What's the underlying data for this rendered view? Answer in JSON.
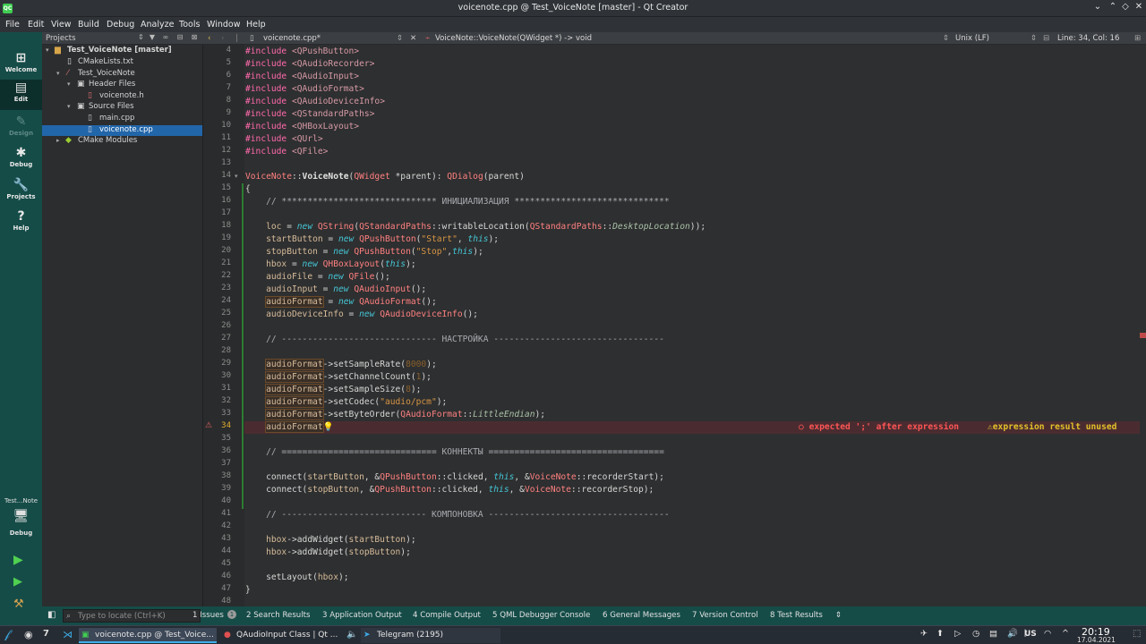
{
  "window": {
    "title": "voicenote.cpp @ Test_VoiceNote [master] - Qt Creator"
  },
  "menu": [
    "File",
    "Edit",
    "View",
    "Build",
    "Debug",
    "Analyze",
    "Tools",
    "Window",
    "Help"
  ],
  "modes": [
    {
      "label": "Welcome",
      "icon": "welcome-icon"
    },
    {
      "label": "Edit",
      "icon": "edit-icon"
    },
    {
      "label": "Design",
      "icon": "design-icon"
    },
    {
      "label": "Debug",
      "icon": "debug-icon"
    },
    {
      "label": "Projects",
      "icon": "projects-icon"
    },
    {
      "label": "Help",
      "icon": "help-icon"
    }
  ],
  "target": {
    "name": "Test...Note",
    "config": "Debug"
  },
  "projects": {
    "header": "Projects",
    "tree": [
      {
        "label": "Test_VoiceNote [master]",
        "level": 0,
        "bold": true,
        "icon": "folder"
      },
      {
        "label": "CMakeLists.txt",
        "level": 1,
        "icon": "file"
      },
      {
        "label": "Test_VoiceNote",
        "level": 1,
        "icon": "target"
      },
      {
        "label": "Header Files",
        "level": 2,
        "icon": "folder"
      },
      {
        "label": "voicenote.h",
        "level": 3,
        "icon": "header"
      },
      {
        "label": "Source Files",
        "level": 2,
        "icon": "folder"
      },
      {
        "label": "main.cpp",
        "level": 3,
        "icon": "cpp"
      },
      {
        "label": "voicenote.cpp",
        "level": 3,
        "icon": "cpp",
        "selected": true
      },
      {
        "label": "CMake Modules",
        "level": 1,
        "icon": "cmake"
      }
    ]
  },
  "editor": {
    "file": "voicenote.cpp*",
    "symbol": "VoiceNote::VoiceNote(QWidget *) -> void",
    "line_ending": "Unix (LF)",
    "cursor": "Line: 34, Col: 16",
    "first_line": 4,
    "error_line": 34,
    "error_msg": "expected ';' after expression",
    "warn_msg": "expression result unused"
  },
  "code": [
    "<span class=\"pp\">#include</span> <span class=\"inc\">&lt;QPushButton&gt;</span>",
    "<span class=\"pp\">#include</span> <span class=\"inc\">&lt;QAudioRecorder&gt;</span>",
    "<span class=\"pp\">#include</span> <span class=\"inc\">&lt;QAudioInput&gt;</span>",
    "<span class=\"pp\">#include</span> <span class=\"inc\">&lt;QAudioFormat&gt;</span>",
    "<span class=\"pp\">#include</span> <span class=\"inc\">&lt;QAudioDeviceInfo&gt;</span>",
    "<span class=\"pp\">#include</span> <span class=\"inc\">&lt;QStandardPaths&gt;</span>",
    "<span class=\"pp\">#include</span> <span class=\"inc\">&lt;QHBoxLayout&gt;</span>",
    "<span class=\"pp\">#include</span> <span class=\"inc\">&lt;QUrl&gt;</span>",
    "<span class=\"pp\">#include</span> <span class=\"inc\">&lt;QFile&gt;</span>",
    "",
    "<span class=\"cls\">VoiceNote</span>::<span class=\"bold\">VoiceNote</span>(<span class=\"cls\">QWidget</span> *parent): <span class=\"cls\">QDialog</span>(parent)",
    "{",
    "    <span class=\"com\">// ****************************** ИНИЦИАЛИЗАЦИЯ ******************************</span>",
    "",
    "    <span class=\"fld\">loc</span> = <span class=\"kw\">new</span> <span class=\"cls\">QString</span>(<span class=\"cls\">QStandardPaths</span>::writableLocation(<span class=\"cls\">QStandardPaths</span>::<span class=\"en\">DesktopLocation</span>));",
    "    <span class=\"fld\">startButton</span> = <span class=\"kw\">new</span> <span class=\"cls\">QPushButton</span>(<span class=\"str\">\"Start\"</span>, <span class=\"kw2\">this</span>);",
    "    <span class=\"fld\">stopButton</span> = <span class=\"kw\">new</span> <span class=\"cls\">QPushButton</span>(<span class=\"str\">\"Stop\"</span>,<span class=\"kw2\">this</span>);",
    "    <span class=\"fld\">hbox</span> = <span class=\"kw\">new</span> <span class=\"cls\">QHBoxLayout</span>(<span class=\"kw2\">this</span>);",
    "    <span class=\"fld\">audioFile</span> = <span class=\"kw\">new</span> <span class=\"cls\">QFile</span>();",
    "    <span class=\"fld\">audioInput</span> = <span class=\"kw\">new</span> <span class=\"cls\">QAudioInput</span>();",
    "    <span class=\"fld box\">audioFormat</span> = <span class=\"kw\">new</span> <span class=\"cls\">QAudioFormat</span>();",
    "    <span class=\"fld\">audioDeviceInfo</span> = <span class=\"kw\">new</span> <span class=\"cls\">QAudioDeviceInfo</span>();",
    "",
    "    <span class=\"com\">// ------------------------------ НАСТРОЙКА ---------------------------------</span>",
    "",
    "    <span class=\"fld box\">audioFormat</span>-&gt;setSampleRate(<span class=\"num\">8000</span>);",
    "    <span class=\"fld box\">audioFormat</span>-&gt;setChannelCount(<span class=\"num\">1</span>);",
    "    <span class=\"fld box\">audioFormat</span>-&gt;setSampleSize(<span class=\"num\">8</span>);",
    "    <span class=\"fld box\">audioFormat</span>-&gt;setCodec(<span class=\"str\">\"audio/pcm\"</span>);",
    "    <span class=\"fld box\">audioFormat</span>-&gt;setByteOrder(<span class=\"cls\">QAudioFormat</span>::<span class=\"en\">LittleEndian</span>);",
    "    <span class=\"fld box\">audioFormat</span><span style=\"color:#e6c229\">💡</span>",
    "",
    "    <span class=\"com\">// ============================== КОННЕКТЫ ==================================</span>",
    "",
    "    connect(<span class=\"fld\">startButton</span>, &amp;<span class=\"cls\">QPushButton</span>::clicked, <span class=\"kw2\">this</span>, &amp;<span class=\"cls\">VoiceNote</span>::recorderStart);",
    "    connect(<span class=\"fld\">stopButton</span>, &amp;<span class=\"cls\">QPushButton</span>::clicked, <span class=\"kw2\">this</span>, &amp;<span class=\"cls\">VoiceNote</span>::recorderStop);",
    "",
    "    <span class=\"com\">// ---------------------------- КОМПОНОВКА -----------------------------------</span>",
    "",
    "    <span class=\"fld\">hbox</span>-&gt;addWidget(<span class=\"fld\">startButton</span>);",
    "    <span class=\"fld\">hbox</span>-&gt;addWidget(<span class=\"fld\">stopButton</span>);",
    "",
    "    setLayout(<span class=\"fld\">hbox</span>);",
    "}",
    ""
  ],
  "status": {
    "locator_placeholder": "Type to locate (Ctrl+K)",
    "panes": [
      "1 Issues",
      "2 Search Results",
      "3 Application Output",
      "4 Compile Output",
      "5 QML Debugger Console",
      "6 General Messages",
      "7 Version Control",
      "8 Test Results"
    ],
    "issues_count": "1"
  },
  "taskbar": {
    "tasks": [
      "voicenote.cpp @ Test_Voice...",
      "QAudioInput Class | Qt ...",
      "Telegram (2195)"
    ],
    "lang": "US",
    "time": "20:19",
    "date": "17.04.2021"
  }
}
